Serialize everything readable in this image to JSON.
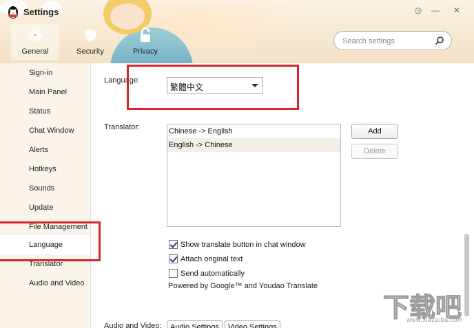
{
  "window": {
    "title": "Settings"
  },
  "top_tabs": [
    {
      "label": "General",
      "icon": "gear-icon",
      "active": true
    },
    {
      "label": "Security",
      "icon": "security-icon",
      "active": false
    },
    {
      "label": "Privacy",
      "icon": "lock-icon",
      "active": false
    }
  ],
  "search": {
    "placeholder": "Search settings"
  },
  "sidebar": {
    "items": [
      {
        "label": "Sign-in"
      },
      {
        "label": "Main Panel"
      },
      {
        "label": "Status"
      },
      {
        "label": "Chat Window"
      },
      {
        "label": "Alerts"
      },
      {
        "label": "Hotkeys"
      },
      {
        "label": "Sounds"
      },
      {
        "label": "Update"
      },
      {
        "label": "File Management"
      },
      {
        "label": "Language",
        "active": true
      },
      {
        "label": "Translator"
      },
      {
        "label": "Audio and Video"
      }
    ]
  },
  "language": {
    "label": "Language:",
    "value": "繁體中文"
  },
  "translator": {
    "label": "Translator:",
    "items": [
      "Chinese -> English",
      "English -> Chinese"
    ],
    "add_label": "Add",
    "delete_label": "Delete"
  },
  "options": {
    "show_translate": {
      "label": "Show translate button in chat window",
      "checked": true
    },
    "attach_original": {
      "label": "Attach original text",
      "checked": true
    },
    "send_auto": {
      "label": "Send automatically",
      "checked": false
    },
    "powered_by": "Powered by Google™ and Youdao Translate"
  },
  "audio_video": {
    "label": "Audio and Video:",
    "audio_btn": "Audio Settings",
    "video_btn": "Video Settings"
  },
  "watermark": {
    "text": "下载吧",
    "url": "www.xiazaiba.com"
  },
  "colors": {
    "annotation_red": "#d8242a",
    "accent_blue": "#1f3a8a",
    "header_bg": "#f6e8d2"
  }
}
